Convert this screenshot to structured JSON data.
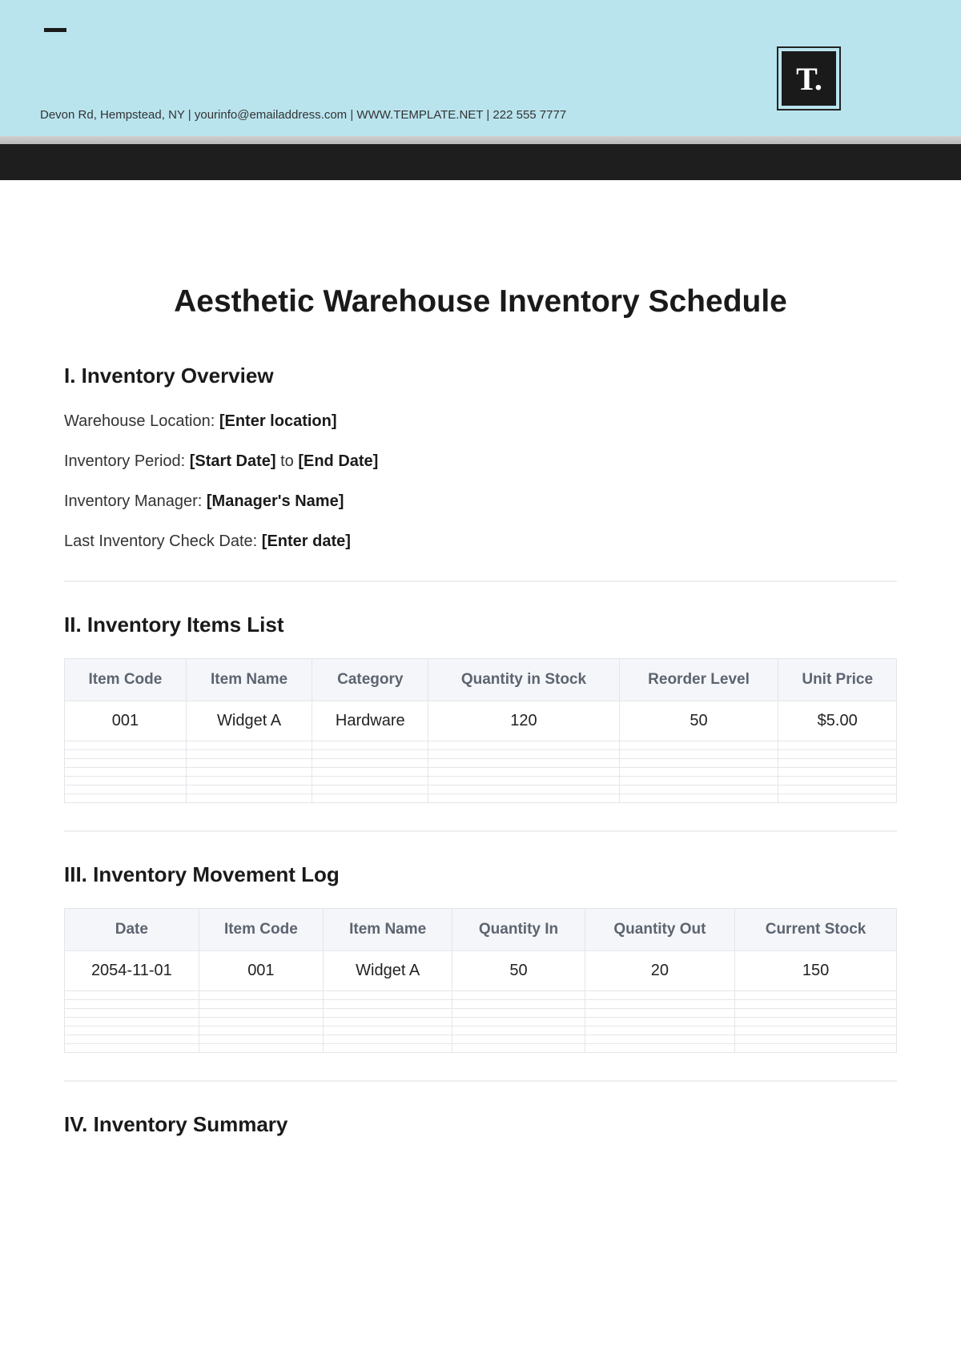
{
  "header": {
    "contact_line": "Devon Rd, Hempstead, NY | yourinfo@emailaddress.com | WWW.TEMPLATE.NET | 222 555 7777",
    "logo_text": "T."
  },
  "doc_title": "Aesthetic Warehouse Inventory Schedule",
  "section1": {
    "heading": "I. Inventory Overview",
    "location_label": "Warehouse Location: ",
    "location_value": "[Enter location]",
    "period_label": "Inventory Period: ",
    "period_start": "[Start Date]",
    "period_to": " to ",
    "period_end": "[End Date]",
    "manager_label": "Inventory Manager: ",
    "manager_value": "[Manager's Name]",
    "lastcheck_label": "Last Inventory Check Date: ",
    "lastcheck_value": "[Enter date]"
  },
  "section2": {
    "heading": "II. Inventory Items List",
    "headers": {
      "c0": "Item Code",
      "c1": "Item Name",
      "c2": "Category",
      "c3": "Quantity in Stock",
      "c4": "Reorder Level",
      "c5": "Unit Price"
    },
    "row0": {
      "c0": "001",
      "c1": "Widget A",
      "c2": "Hardware",
      "c3": "120",
      "c4": "50",
      "c5": "$5.00"
    }
  },
  "section3": {
    "heading": "III. Inventory Movement Log",
    "headers": {
      "c0": "Date",
      "c1": "Item Code",
      "c2": "Item Name",
      "c3": "Quantity In",
      "c4": "Quantity Out",
      "c5": "Current Stock"
    },
    "row0": {
      "c0": "2054-11-01",
      "c1": "001",
      "c2": "Widget A",
      "c3": "50",
      "c4": "20",
      "c5": "150"
    }
  },
  "section4": {
    "heading": "IV. Inventory Summary"
  }
}
